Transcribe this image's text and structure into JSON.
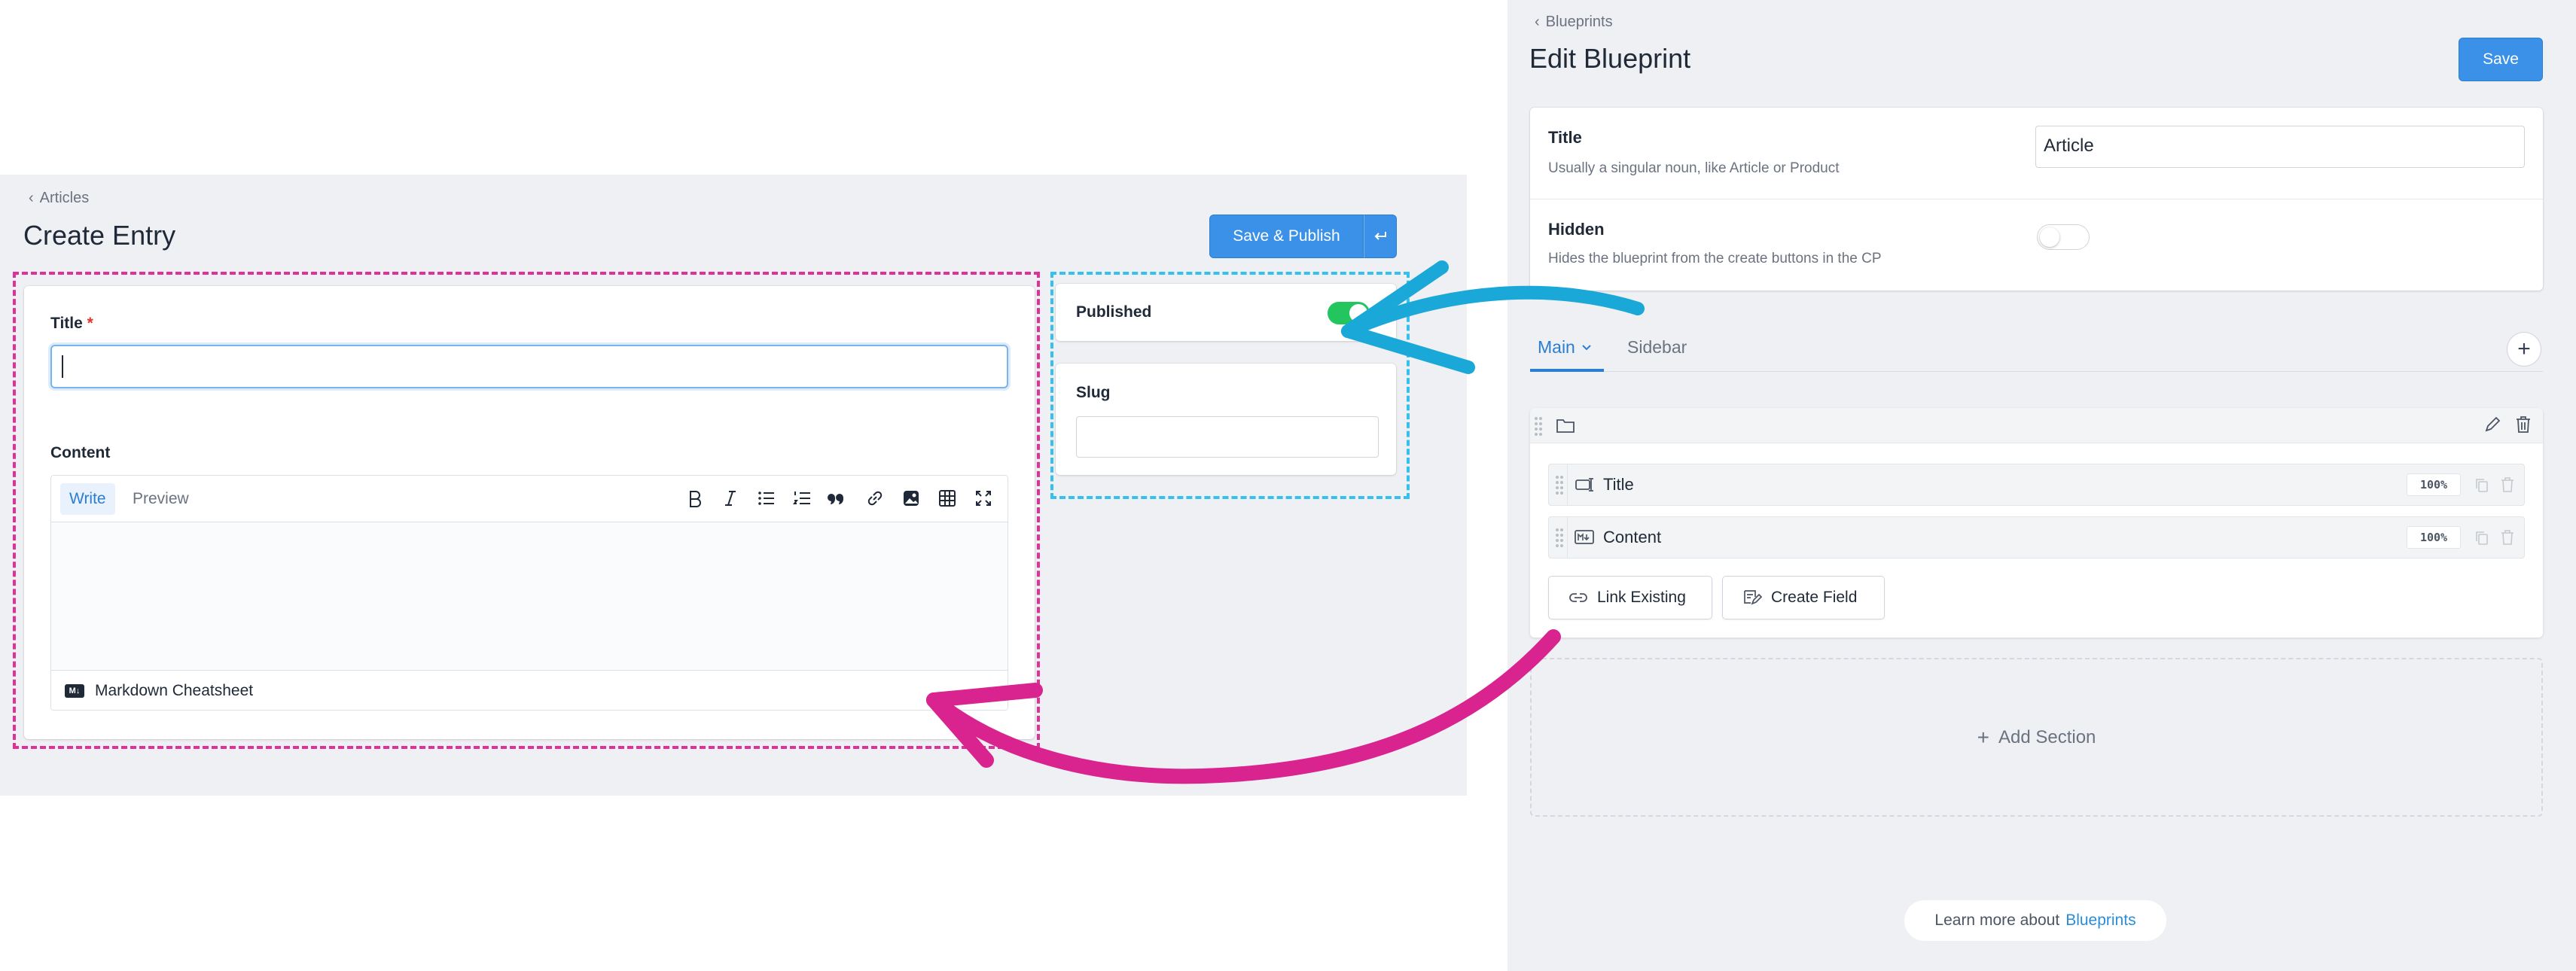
{
  "entry_form": {
    "breadcrumb": "Articles",
    "title": "Create Entry",
    "save_publish_label": "Save & Publish",
    "fields": {
      "title_label": "Title",
      "required_marker": "*",
      "title_value": "",
      "content_label": "Content"
    },
    "editor": {
      "tab_write": "Write",
      "tab_preview": "Preview",
      "toolbar_icons": [
        "bold-icon",
        "italic-icon",
        "bullet-list-icon",
        "ordered-list-icon",
        "quote-icon",
        "link-icon",
        "image-icon",
        "table-icon",
        "fullscreen-icon"
      ],
      "footer_badge": "M↓",
      "footer_label": "Markdown Cheatsheet"
    },
    "sidebar": {
      "published_label": "Published",
      "published": true,
      "slug_label": "Slug",
      "slug_value": ""
    }
  },
  "blueprint": {
    "breadcrumb": "Blueprints",
    "title": "Edit Blueprint",
    "save_label": "Save",
    "settings": {
      "title_label": "Title",
      "title_help": "Usually a singular noun, like Article or Product",
      "title_value": "Article",
      "hidden_label": "Hidden",
      "hidden_help": "Hides the blueprint from the create buttons in the CP",
      "hidden": false
    },
    "tabs": [
      {
        "label": "Main",
        "active": true
      },
      {
        "label": "Sidebar",
        "active": false
      }
    ],
    "fields": [
      {
        "name": "Title",
        "width": "100%",
        "icon": "text-field-icon"
      },
      {
        "name": "Content",
        "width": "100%",
        "icon": "markdown-icon"
      }
    ],
    "link_existing_label": "Link Existing",
    "create_field_label": "Create Field",
    "add_section_label": "Add Section",
    "learn_more_prefix": "Learn more about",
    "learn_more_link": "Blueprints"
  },
  "colors": {
    "accent_blue": "#3b91e8",
    "toggle_on": "#22c55e",
    "pink_annotation": "#e0309a",
    "cyan_annotation": "#35c0ee",
    "panel_bg": "#eef0f4"
  }
}
